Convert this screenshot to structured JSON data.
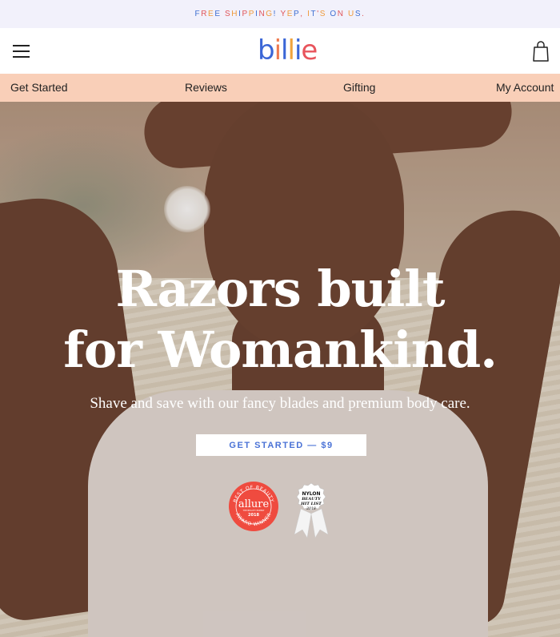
{
  "promo": {
    "text": "FREE SHIPPING! YEP, IT'S ON US."
  },
  "header": {
    "logo_text": "billie",
    "menu_icon": "hamburger-icon",
    "cart_icon": "shopping-bag-icon"
  },
  "nav": {
    "items": [
      {
        "label": "Get Started"
      },
      {
        "label": "Reviews"
      },
      {
        "label": "Gifting"
      },
      {
        "label": "My Account"
      }
    ]
  },
  "hero": {
    "headline_line1": "Razors built",
    "headline_line2": "for Womankind.",
    "subheadline": "Shave and save with our fancy blades and premium body care.",
    "cta_label": "GET STARTED — $9"
  },
  "badges": {
    "allure": {
      "top": "BEST OF BEAUTY",
      "brand": "allure",
      "small": "THE BEAUTY EXPERT",
      "year": "2018",
      "bottom": "AWARD WINNER"
    },
    "nylon": {
      "line1": "NYLON",
      "line2": "BEAUTY",
      "line3": "HIT LIST",
      "line4": "2018"
    }
  },
  "colors": {
    "promo_bg": "#f2f1fb",
    "nav_bg": "#f9cfb8",
    "brand_blue": "#3b66d6",
    "brand_red": "#e8545c",
    "brand_orange": "#f0a33c"
  }
}
